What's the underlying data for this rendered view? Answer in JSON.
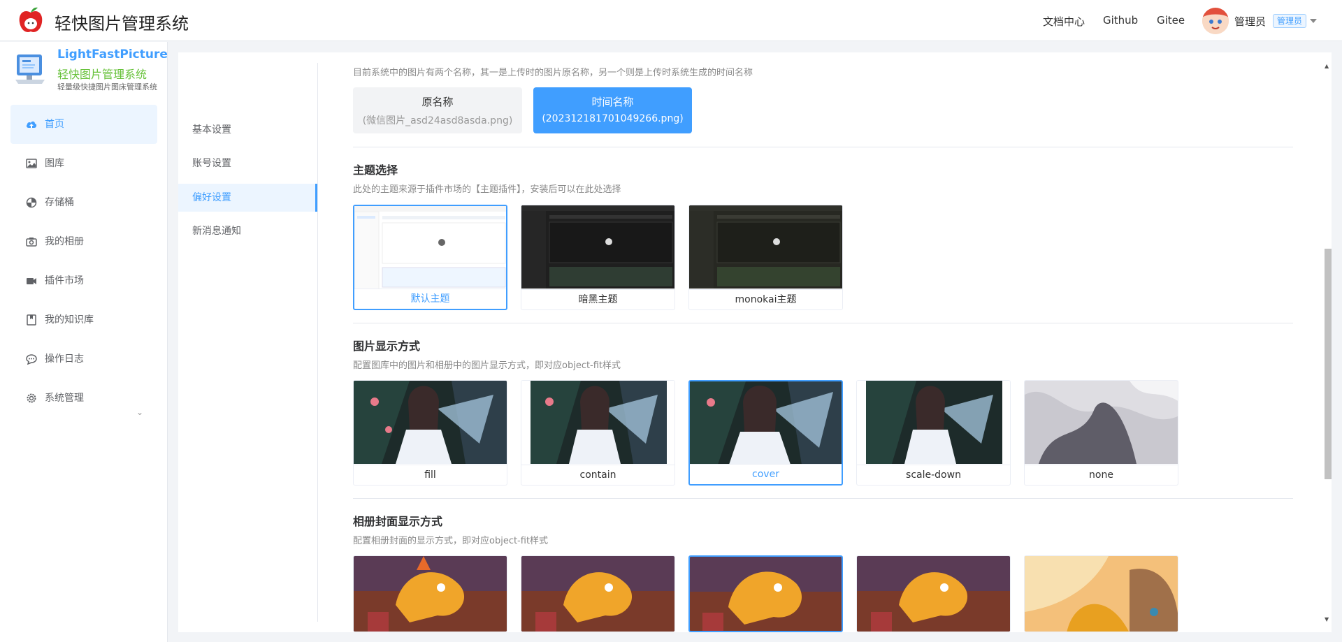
{
  "header": {
    "app_title": "轻快图片管理系统",
    "links": [
      "文档中心",
      "Github",
      "Gitee"
    ],
    "user_name": "管理员",
    "role_badge": "管理员"
  },
  "sidebar": {
    "brand_en": "LightFastPicture",
    "brand_cn": "轻快图片管理系统",
    "brand_sub": "轻量级快捷图片图床管理系统",
    "items": [
      {
        "label": "首页",
        "icon": "cloud-upload-icon",
        "active": true
      },
      {
        "label": "图库",
        "icon": "picture-icon"
      },
      {
        "label": "存储桶",
        "icon": "bucket-icon"
      },
      {
        "label": "我的相册",
        "icon": "camera-icon"
      },
      {
        "label": "插件市场",
        "icon": "plugin-icon"
      },
      {
        "label": "我的知识库",
        "icon": "book-icon"
      },
      {
        "label": "操作日志",
        "icon": "chat-icon"
      },
      {
        "label": "系统管理",
        "icon": "gear-icon",
        "has_children": true
      }
    ]
  },
  "subnav": {
    "items": [
      {
        "label": "基本设置"
      },
      {
        "label": "账号设置"
      },
      {
        "label": "偏好设置",
        "active": true
      },
      {
        "label": "新消息通知"
      }
    ]
  },
  "preferences": {
    "naming": {
      "desc": "目前系统中的图片有两个名称，其一是上传时的图片原名称，另一个则是上传时系统生成的时间名称",
      "original": {
        "title": "原名称",
        "sample": "(微信图片_asd24asd8asda.png)"
      },
      "time": {
        "title": "时间名称",
        "sample": "(20231218170104926​6.png)",
        "selected": true
      }
    },
    "theme": {
      "title": "主题选择",
      "desc": "此处的主题来源于插件市场的【主题插件】，安装后可以在此处选择",
      "options": [
        {
          "label": "默认主题",
          "selected": true
        },
        {
          "label": "暗黑主题"
        },
        {
          "label": "monokai主题"
        }
      ]
    },
    "image_fit": {
      "title": "图片显示方式",
      "desc": "配置图库中的图片和相册中的图片显示方式，即对应object-fit样式",
      "options": [
        {
          "label": "fill"
        },
        {
          "label": "contain"
        },
        {
          "label": "cover",
          "selected": true
        },
        {
          "label": "scale-down"
        },
        {
          "label": "none"
        }
      ]
    },
    "album_cover": {
      "title": "相册封面显示方式",
      "desc": "配置相册封面的显示方式，即对应object-fit样式",
      "selected_index": 2
    }
  }
}
